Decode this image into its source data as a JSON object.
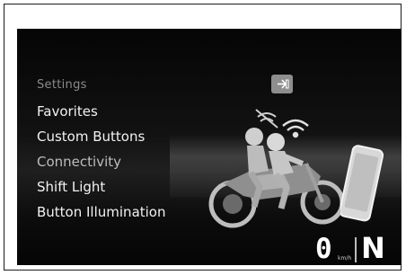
{
  "menu": {
    "header": "Settings",
    "items": [
      {
        "label": "Favorites"
      },
      {
        "label": "Custom Buttons"
      },
      {
        "label": "Connectivity",
        "selected": true
      },
      {
        "label": "Shift Light"
      },
      {
        "label": "Button Illumination"
      }
    ]
  },
  "exit_button": {
    "icon": "exit-arrow-icon"
  },
  "status": {
    "speed": "0",
    "speed_unit": "km/h",
    "gear": "N"
  },
  "illustration": {
    "icons": [
      "motorcycle-riders-icon",
      "wifi-signal-icon",
      "smartphone-icon"
    ]
  },
  "colors": {
    "background": "#050505",
    "text": "#f2f2f2",
    "header_text": "#8a8a8a",
    "selected_text": "#bdbdbd",
    "button_bg": "#8e8e8e"
  }
}
